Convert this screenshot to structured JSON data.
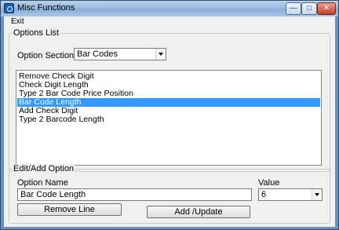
{
  "window": {
    "title": "Misc Functions",
    "controls": {
      "minimize": "—",
      "maximize": "□",
      "close": "✕"
    }
  },
  "menu": {
    "exit": "Exit"
  },
  "options_list": {
    "legend": "Options List",
    "sections_label": "Option Sections",
    "sections_value": "Bar Codes",
    "items": [
      {
        "label": "Remove Check Digit",
        "selected": false
      },
      {
        "label": "Check Digit Length",
        "selected": false
      },
      {
        "label": "Type 2 Bar Code Price Position",
        "selected": false
      },
      {
        "label": "Bar Code Length",
        "selected": true
      },
      {
        "label": "Add Check Digit",
        "selected": false
      },
      {
        "label": "Type 2 Barcode Length",
        "selected": false
      }
    ]
  },
  "edit_add": {
    "legend": "Edit/Add Option",
    "name_label": "Option Name",
    "name_value": "Bar Code Length",
    "value_label": "Value",
    "value_value": "6",
    "remove_button": "Remove Line",
    "add_button": "Add /Update"
  }
}
